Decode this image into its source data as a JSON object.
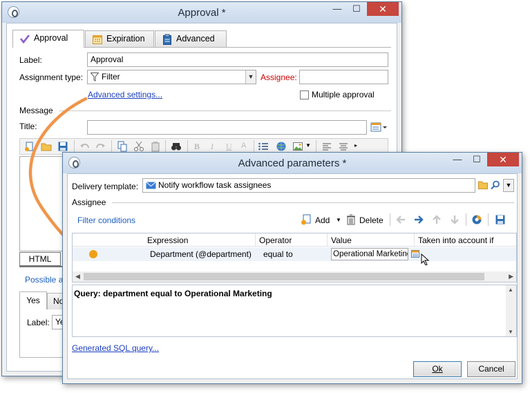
{
  "approval_window": {
    "title": "Approval *",
    "controls": {
      "minimize": "—",
      "maximize": "☐",
      "close": "✕"
    },
    "tabs": [
      {
        "label": "Approval",
        "icon": "checkmark-icon"
      },
      {
        "label": "Expiration",
        "icon": "calendar-icon"
      },
      {
        "label": "Advanced",
        "icon": "clipboard-icon"
      }
    ],
    "label_caption": "Label:",
    "label_value": "Approval",
    "assignment_caption": "Assignment type:",
    "assignment_value": "Filter",
    "assignee_caption": "Assignee:",
    "advanced_settings_link": "Advanced settings...",
    "multiple_approval_label": "Multiple approval",
    "message_section": "Message",
    "title_caption": "Title:",
    "html_tab": "HTML",
    "possible_answers_partial": "Possible a",
    "answers_tabs": [
      "Yes",
      "No"
    ],
    "bottom_label_caption": "Label:",
    "bottom_label_value": "Ye"
  },
  "advanced_window": {
    "title": "Advanced parameters *",
    "controls": {
      "minimize": "—",
      "maximize": "☐",
      "close": "✕"
    },
    "delivery_template_caption": "Delivery template:",
    "delivery_template_value": "Notify workflow task assignees",
    "assignee_section": "Assignee",
    "filter_conditions_link": "Filter conditions",
    "add_label": "Add",
    "delete_label": "Delete",
    "columns": [
      "Expression",
      "Operator",
      "Value",
      "Taken into account if"
    ],
    "rows": [
      {
        "expression": "Department (@department)",
        "operator": "equal to",
        "value": "Operational Marketing"
      }
    ],
    "query_text": "Query: department equal to Operational Marketing",
    "generated_sql_link": "Generated SQL query...",
    "ok_label": "Ok",
    "cancel_label": "Cancel"
  },
  "colors": {
    "arrow": "#f0954a",
    "link": "#1c3fbf",
    "assignee_red": "#cc0000",
    "close_button": "#c7463d",
    "condition_dot": "#f0a018"
  }
}
